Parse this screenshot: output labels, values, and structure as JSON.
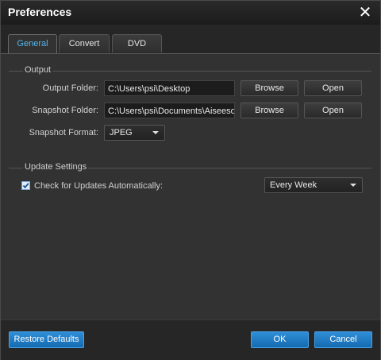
{
  "window": {
    "title": "Preferences",
    "close_glyph": "✕"
  },
  "tabs": [
    {
      "label": "General",
      "active": true
    },
    {
      "label": "Convert",
      "active": false
    },
    {
      "label": "DVD",
      "active": false
    }
  ],
  "output": {
    "section_label": "Output",
    "output_folder": {
      "label": "Output Folder:",
      "value": "C:\\Users\\psi\\Desktop",
      "browse_label": "Browse",
      "open_label": "Open"
    },
    "snapshot_folder": {
      "label": "Snapshot Folder:",
      "value": "C:\\Users\\psi\\Documents\\Aiseesoft",
      "browse_label": "Browse",
      "open_label": "Open"
    },
    "snapshot_format": {
      "label": "Snapshot Format:",
      "selected": "JPEG"
    }
  },
  "update": {
    "section_label": "Update Settings",
    "check_label": "Check for Updates Automatically:",
    "checked": true,
    "frequency_selected": "Every Week"
  },
  "footer": {
    "restore_label": "Restore Defaults",
    "ok_label": "OK",
    "cancel_label": "Cancel"
  },
  "colors": {
    "accent": "#52b8ee",
    "button_blue": "#1f7fc8",
    "background": "#323232"
  }
}
